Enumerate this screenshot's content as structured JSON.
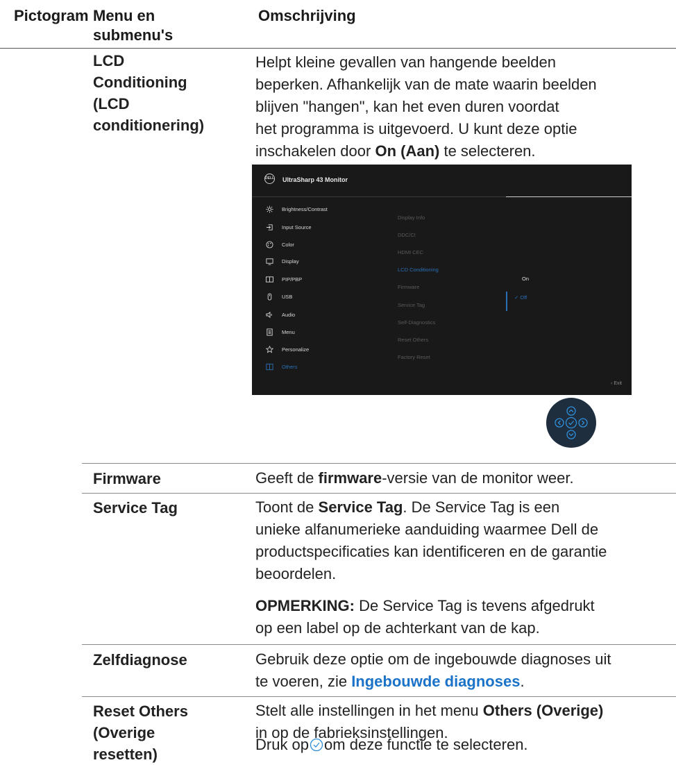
{
  "header": {
    "col1": "Pictogram",
    "col2_line1": "Menu en",
    "col2_line2": "submenu's",
    "col3": "Omschrijving"
  },
  "lcd": {
    "label_lines": [
      "LCD",
      "Conditioning",
      "(LCD",
      "conditionering)"
    ],
    "desc_lines": [
      "Helpt kleine gevallen van hangende beelden",
      "beperken. Afhankelijk van de mate waarin beelden",
      "blijven \"hangen\", kan het even duren voordat",
      "het programma is uitgevoerd. U kunt deze optie"
    ],
    "desc_last_pre": "inschakelen door ",
    "desc_last_bold": "On (Aan)",
    "desc_last_post": " te selecteren."
  },
  "osd": {
    "logo": "DELL",
    "title": "UltraSharp 43 Monitor",
    "menu": [
      {
        "label": "Brightness/Contrast",
        "icon": "brightness-icon"
      },
      {
        "label": "Input Source",
        "icon": "input-source-icon"
      },
      {
        "label": "Color",
        "icon": "color-icon"
      },
      {
        "label": "Display",
        "icon": "display-icon"
      },
      {
        "label": "PIP/PBP",
        "icon": "pip-pbp-icon"
      },
      {
        "label": "USB",
        "icon": "usb-icon"
      },
      {
        "label": "Audio",
        "icon": "audio-icon"
      },
      {
        "label": "Menu",
        "icon": "menu-icon"
      },
      {
        "label": "Personalize",
        "icon": "star-icon"
      },
      {
        "label": "Others",
        "icon": "others-icon"
      }
    ],
    "submenu": [
      "Display Info",
      "DDC/CI",
      "HDMI CEC",
      "LCD Conditioning",
      "Firmware",
      "Service Tag",
      "Self-Diagnostics",
      "Reset Others",
      "Factory Reset"
    ],
    "options": [
      "On",
      "Off"
    ],
    "exit": "Exit",
    "selected_color": "#2b6fb5"
  },
  "firmware": {
    "label": "Firmware",
    "desc_pre": "Geeft de ",
    "desc_bold": "firmware",
    "desc_post": "-versie van de monitor weer."
  },
  "service_tag": {
    "label": "Service Tag",
    "line1_pre": "Toont de ",
    "line1_bold": "Service Tag",
    "line1_post": ". De Service Tag is een",
    "lines": [
      "unieke alfanumerieke aanduiding waarmee Dell de",
      "productspecificaties kan identificeren en de garantie",
      "beoordelen."
    ],
    "note_bold": "OPMERKING:",
    "note_line1": " De Service Tag is tevens afgedrukt",
    "note_line2": "op een label op de achterkant van de kap."
  },
  "self_diag": {
    "label": "Zelfdiagnose",
    "line1": "Gebruik deze optie om de ingebouwde diagnoses uit",
    "line2_pre": "te voeren, zie ",
    "line2_link": "Ingebouwde diagnoses",
    "line2_post": "."
  },
  "reset_others": {
    "label_lines": [
      "Reset Others",
      "(Overige",
      "resetten)"
    ],
    "line1_pre": "Stelt alle instellingen in het menu ",
    "line1_bold": "Others (Overige)",
    "line2": "in op de fabrieksinstellingen.",
    "line3_pre": "Druk op",
    "line3_post": " om deze functie te selecteren."
  },
  "link_color": "#1a73c8"
}
